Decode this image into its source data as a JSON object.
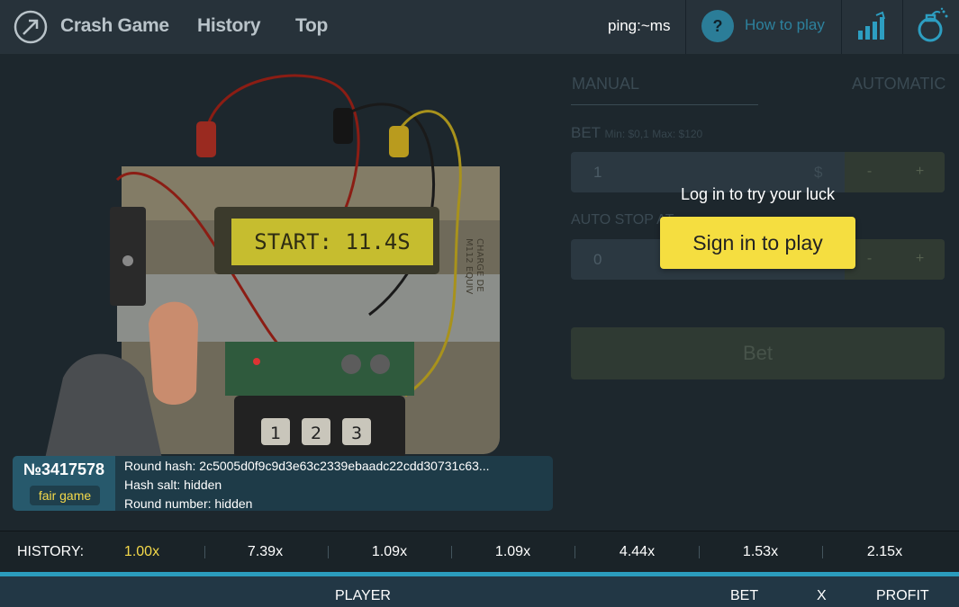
{
  "nav": {
    "items": [
      "Crash Game",
      "History",
      "Top"
    ],
    "ping": "ping:~ms",
    "how_to_play": "How to play",
    "help_glyph": "?",
    "icons": [
      "logo-arrow-icon",
      "question-icon",
      "signal-icon",
      "bomb-icon"
    ]
  },
  "scene": {
    "display_text": "START: 11.4S",
    "keypad": [
      "1",
      "2",
      "3"
    ],
    "label_side": "CHARGE DE",
    "label_side2": "M112 EQUIV"
  },
  "round": {
    "number": "№3417578",
    "badge": "fair game",
    "hash": "Round hash: 2c5005d0f9c9d3e63c2339ebaadc22cdd30731c63...",
    "salt": "Hash salt: hidden",
    "round_number": "Round number: hidden"
  },
  "panel": {
    "tab_manual": "MANUAL",
    "tab_auto": "AUTOMATIC",
    "bet_label": "BET",
    "bet_limits": "Min: $0,1 Max: $120",
    "bet_value": "1",
    "currency": "$",
    "minus": "-",
    "plus": "+",
    "autostop_label": "AUTO STOP AT",
    "autostop_value": "0",
    "bet_button": "Bet"
  },
  "login": {
    "prompt": "Log in to try your luck",
    "button": "Sign in to play"
  },
  "history": {
    "label": "HISTORY:",
    "values": [
      "1.00x",
      "7.39x",
      "1.09x",
      "1.09x",
      "4.44x",
      "1.53x",
      "2.15x"
    ],
    "highlight_color": "#f4d94a"
  },
  "players": {
    "columns": [
      "PLAYER",
      "BET",
      "X",
      "PROFIT"
    ]
  },
  "colors": {
    "accent": "#2b9cbd",
    "signin": "#f5de40"
  }
}
